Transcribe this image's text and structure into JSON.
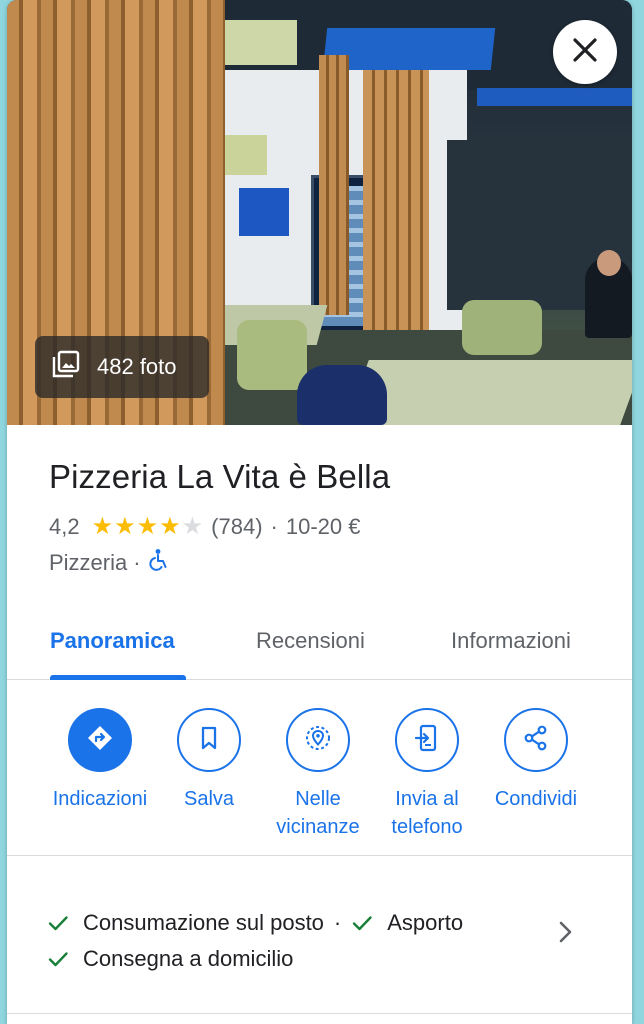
{
  "hero": {
    "photo_count_label": "482 foto"
  },
  "place": {
    "name": "Pizzeria La Vita è Bella",
    "rating": "4,2",
    "stars_filled": 4,
    "stars_total": 5,
    "review_count": "(784)",
    "separator": "·",
    "price_range": "10-20 €",
    "category": "Pizzeria",
    "category_separator": "·"
  },
  "tabs": [
    {
      "label": "Panoramica",
      "active": true
    },
    {
      "label": "Recensioni",
      "active": false
    },
    {
      "label": "Informazioni",
      "active": false
    }
  ],
  "actions": [
    {
      "label": "Indicazioni",
      "icon": "directions-icon"
    },
    {
      "label": "Salva",
      "icon": "bookmark-icon"
    },
    {
      "label": "Nelle\nvicinanze",
      "icon": "nearby-icon"
    },
    {
      "label": "Invia al\ntelefono",
      "icon": "send-to-phone-icon"
    },
    {
      "label": "Condividi",
      "icon": "share-icon"
    }
  ],
  "features": {
    "dine_in": "Consumazione sul posto",
    "separator": "·",
    "takeaway": "Asporto",
    "delivery": "Consegna a domicilio"
  },
  "colors": {
    "accent": "#1a73e8",
    "star": "#fbbc04",
    "check": "#188038"
  }
}
